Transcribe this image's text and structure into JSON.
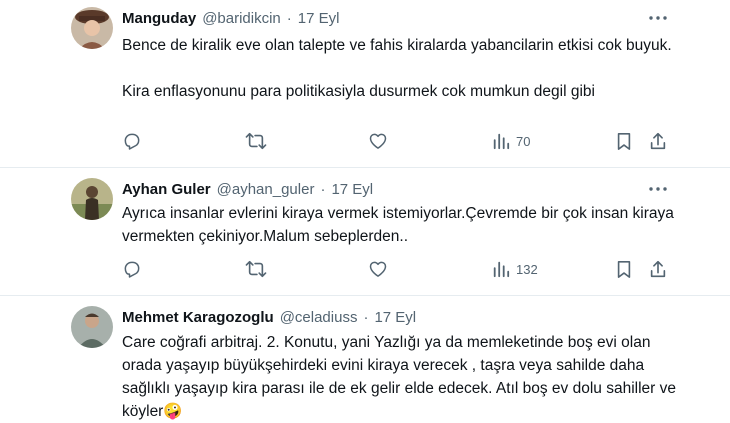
{
  "tweets": [
    {
      "name": "Manguday",
      "handle": "@baridikcin",
      "separator": "·",
      "date": "17 Eyl",
      "paragraphs": [
        "Bence de kiralik eve olan talepte ve fahis kiralarda yabancilarin etkisi cok buyuk.",
        "Kira enflasyonunu para politikasiyla dusurmek cok mumkun degil gibi"
      ],
      "views": "70",
      "avatar_color": "#8a5a44"
    },
    {
      "name": "Ayhan Guler",
      "handle": "@ayhan_guler",
      "separator": "·",
      "date": "17 Eyl",
      "paragraphs": [
        "Ayrıca insanlar evlerini kiraya vermek istemiyorlar.Çevremde bir çok insan kiraya vermekten çekiniyor.Malum sebeplerden.."
      ],
      "views": "132",
      "avatar_color": "#6f7a4a"
    },
    {
      "name": "Mehmet Karagozoglu",
      "handle": "@celadiuss",
      "separator": "·",
      "date": "17 Eyl",
      "paragraphs": [
        "Care coğrafi arbitraj. 2. Konutu, yani Yazlığı ya da memleketinde boş evi olan orada yaşayıp büyükşehirdeki evini kiraya verecek , taşra veya sahilde daha sağlıklı yaşayıp kira parası ile de ek gelir elde edecek. Atıl boş ev dolu sahiller ve köyler🤪"
      ],
      "avatar_color": "#7d6a5a"
    }
  ],
  "icons": {
    "reply": "reply-icon",
    "retweet": "retweet-icon",
    "like": "heart-icon",
    "views": "views-icon",
    "bookmark": "bookmark-icon",
    "share": "share-icon",
    "more": "more-icon"
  },
  "colors": {
    "text": "#0f1419",
    "secondary": "#536471",
    "divider": "#e6ecf0"
  }
}
